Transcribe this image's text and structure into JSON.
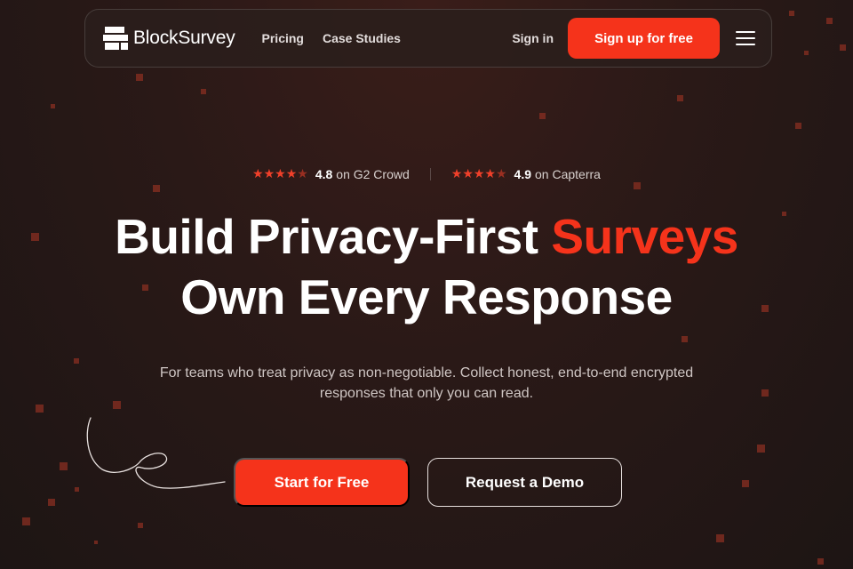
{
  "brand": {
    "name": "BlockSurvey"
  },
  "nav": {
    "links": [
      "Pricing",
      "Case Studies"
    ],
    "sign_in": "Sign in",
    "signup": "Sign up for free"
  },
  "ratings": [
    {
      "score": "4.8",
      "source": "on G2 Crowd",
      "stars": 4.5
    },
    {
      "score": "4.9",
      "source": "on Capterra",
      "stars": 4.5
    }
  ],
  "hero": {
    "line1_main": "Build Privacy-First ",
    "line1_accent": "Surveys",
    "line2": "Own Every Response",
    "sub_line1": "For teams who treat privacy as non-negotiable. Collect honest, end-to-end encrypted",
    "sub_line2": "responses that only you can read.",
    "primary_cta": "Start for Free",
    "secondary_cta": "Request a Demo"
  },
  "colors": {
    "accent": "#f5331b",
    "background": "#2a1917",
    "star": "#f0402a"
  },
  "icons": {
    "logo": "blocksurvey-logo-icon",
    "menu": "hamburger-menu-icon",
    "star": "star-icon",
    "decoration": "squiggle-arrow-icon"
  }
}
